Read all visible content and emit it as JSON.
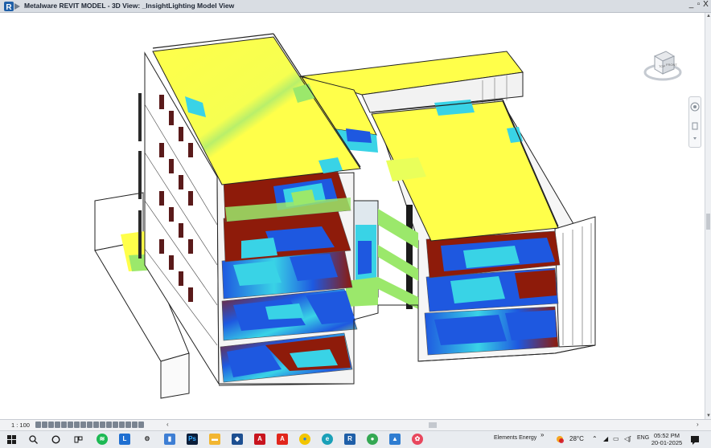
{
  "window": {
    "title": "Metalware  REVIT MODEL - 3D View: _InsightLighting Model View",
    "controls": [
      "_",
      "̵□",
      "X"
    ]
  },
  "viewcube": {
    "face_top": "TOP",
    "face_front": "FRONT"
  },
  "statusbar": {
    "scale": "1 : 100"
  },
  "taskbar": {
    "weather_label": "Elements Energy",
    "temperature": "28°C",
    "language": "ENG",
    "time": "05:52 PM",
    "date": "20-01-2025",
    "notification_badge": "4",
    "apps": [
      "windows-start",
      "search",
      "task-view",
      "widgets",
      "spotify",
      "lens",
      "settings",
      "explorer",
      "photoshop",
      "file-manager",
      "sketchup",
      "acrobat",
      "autocad",
      "chrome",
      "edge",
      "revit",
      "chrome-profile",
      "photos",
      "paint"
    ]
  },
  "colors": {
    "lux_high": "#ffff4a",
    "lux_mid_green": "#9be86b",
    "lux_mid_cyan": "#39d3e6",
    "lux_low_blue": "#1e58e0",
    "lux_none_red": "#8e1b0a",
    "accent": "#2e6fd1"
  }
}
